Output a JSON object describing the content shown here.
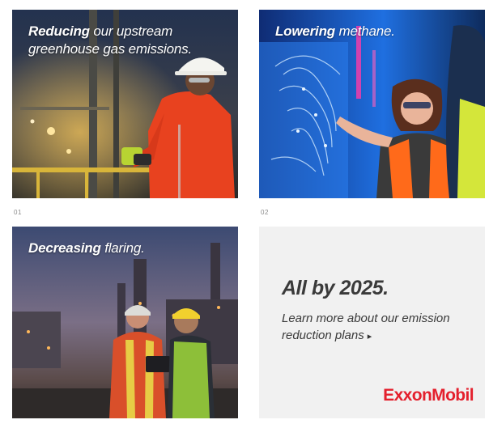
{
  "tiles": [
    {
      "caption_bold": "Reducing",
      "caption_rest": " our upstream greenhouse gas emissions.",
      "number": "01"
    },
    {
      "caption_bold": "Lowering",
      "caption_rest": " methane.",
      "number": "02"
    },
    {
      "caption_bold": "Decreasing",
      "caption_rest": " flaring.",
      "number": ""
    }
  ],
  "cta": {
    "heading": "All by 2025.",
    "link_text": "Learn more about our emission reduction plans",
    "arrow": "▸"
  },
  "brand": {
    "logo_text": "ExxonMobil",
    "logo_color": "#e4202d"
  },
  "colors": {
    "coverall_orange": "#e8421f",
    "screen_blue": "#1f6fe0",
    "cta_background": "#f1f1f1"
  }
}
